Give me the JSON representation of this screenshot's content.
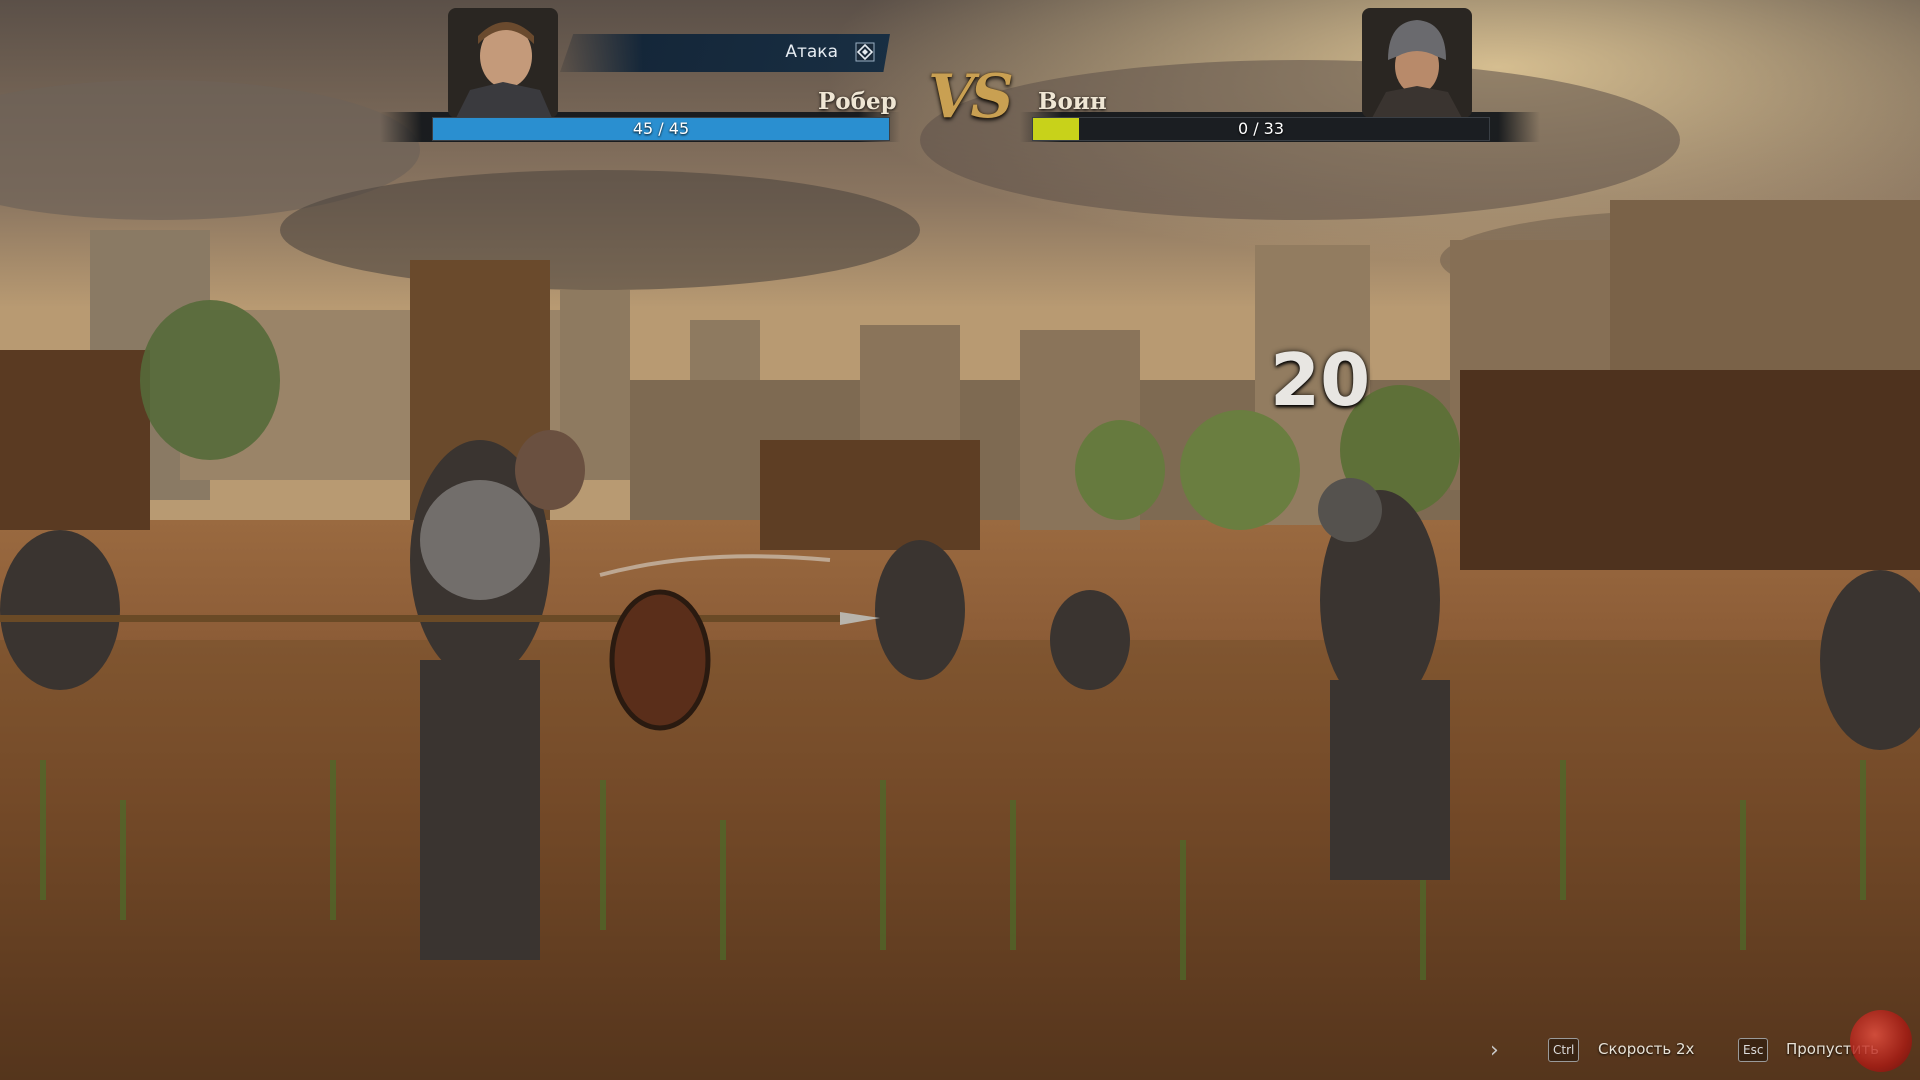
{
  "player": {
    "name": "Робер",
    "hp_text": "45 / 45",
    "hp_fraction": 1.0,
    "bar_color": "#2a8fd0"
  },
  "enemy": {
    "name": "Воин",
    "hp_text": "0 / 33",
    "hp_fraction": 0.1,
    "bar_color": "#c8d21a"
  },
  "action": {
    "label": "Атака",
    "icon": "diamond-action-icon"
  },
  "vs_label": "VS",
  "damage_number": "20",
  "controls": {
    "speed_key": "Ctrl",
    "speed_label": "Скорость 2x",
    "skip_key": "Esc",
    "skip_label": "Пропустить"
  },
  "colors": {
    "vs_gold": "#c9a052",
    "hud_dark": "#12161a",
    "action_plate": "#142c42"
  }
}
